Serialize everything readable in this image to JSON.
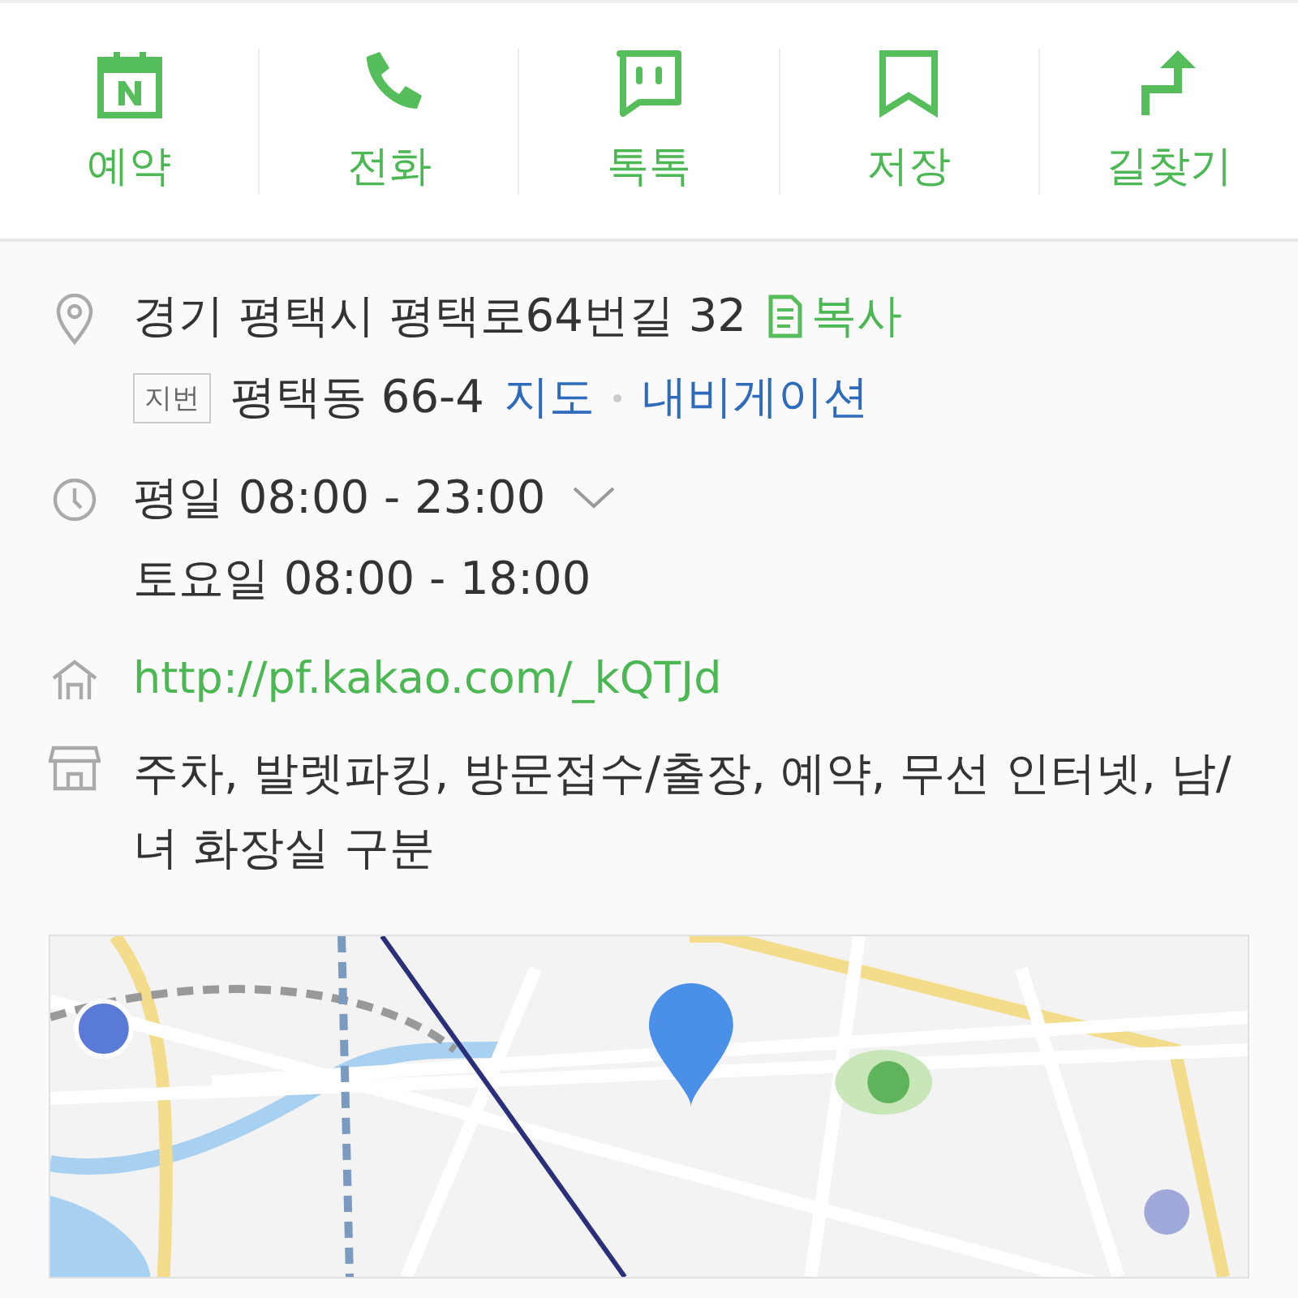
{
  "actions": [
    {
      "kind": "calendar",
      "label": "예약"
    },
    {
      "kind": "phone",
      "label": "전화"
    },
    {
      "kind": "chat",
      "label": "톡톡"
    },
    {
      "kind": "bookmark",
      "label": "저장"
    },
    {
      "kind": "directions",
      "label": "길찾기"
    }
  ],
  "address": {
    "road": "경기 평택시 평택로64번길 32",
    "copy_label": "복사",
    "lot_tag": "지번",
    "lot": "평택동 66-4",
    "map_link": "지도",
    "navigation_link": "내비게이션"
  },
  "hours": {
    "expanded": false,
    "lines": [
      "평일 08:00 - 23:00",
      "토요일 08:00 - 18:00"
    ]
  },
  "website": "http://pf.kakao.com/_kQTJd",
  "amenities": "주차, 발렛파킹, 방문접수/출장, 예약, 무선 인터넷, 남/녀 화장실 구분"
}
